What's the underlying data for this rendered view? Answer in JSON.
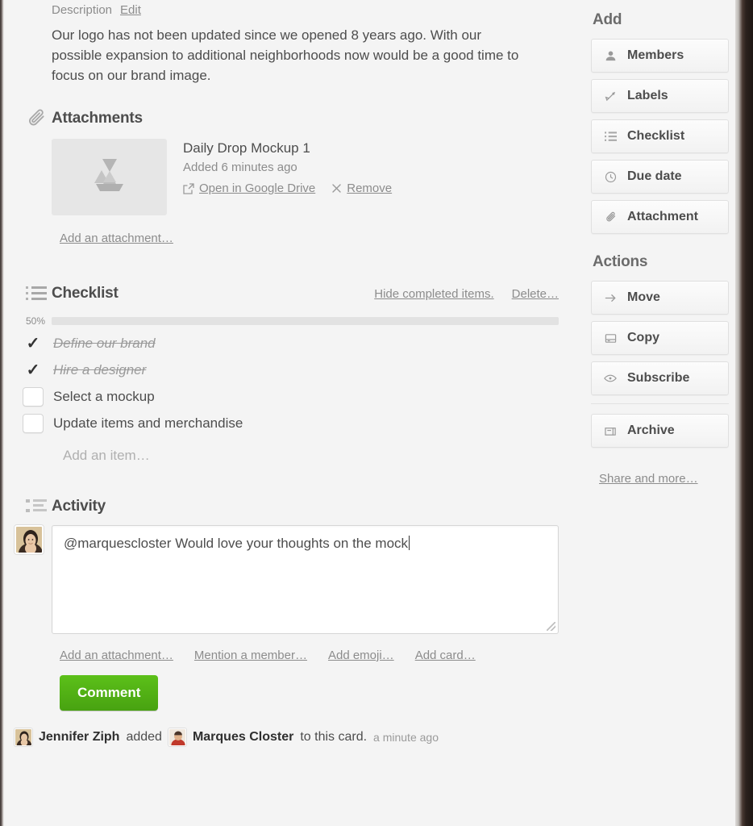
{
  "description": {
    "label": "Description",
    "edit_label": "Edit",
    "text": "Our logo has not been updated since we opened 8 years ago. With our possible expansion to additional neighborhoods now would be a good time to focus on our brand image."
  },
  "attachments": {
    "title": "Attachments",
    "icon": "paperclip-icon",
    "items": [
      {
        "name": "Daily Drop Mockup 1",
        "added": "Added 6 minutes ago",
        "thumb_icon": "google-drive-icon",
        "open_label": "Open in Google Drive",
        "remove_label": "Remove"
      }
    ],
    "add_label": "Add an attachment…"
  },
  "checklist": {
    "title": "Checklist",
    "icon": "checklist-icon",
    "hide_completed_label": "Hide completed items.",
    "delete_label": "Delete…",
    "progress_percent": "50%",
    "progress_value": 50,
    "items": [
      {
        "text": "Define our brand",
        "checked": true
      },
      {
        "text": "Hire a designer",
        "checked": true
      },
      {
        "text": "Select a mockup",
        "checked": false
      },
      {
        "text": "Update items and merchandise",
        "checked": false
      }
    ],
    "add_item_label": "Add an item…"
  },
  "activity": {
    "title": "Activity",
    "icon": "activity-icon",
    "comment_value": "@marquescloster Would love your thoughts on the mock",
    "comment_links": [
      "Add an attachment…",
      "Mention a member…",
      "Add emoji…",
      "Add card…"
    ],
    "comment_button": "Comment",
    "entries": [
      {
        "actor": "Jennifer Ziph",
        "verb": "added",
        "target": "Marques Closter",
        "suffix": "to this card.",
        "time": "a minute ago"
      }
    ]
  },
  "sidebar": {
    "add_title": "Add",
    "add_items": [
      {
        "label": "Members",
        "icon": "person-icon"
      },
      {
        "label": "Labels",
        "icon": "tag-icon"
      },
      {
        "label": "Checklist",
        "icon": "checklist-icon"
      },
      {
        "label": "Due date",
        "icon": "clock-icon"
      },
      {
        "label": "Attachment",
        "icon": "paperclip-icon"
      }
    ],
    "actions_title": "Actions",
    "action_items": [
      {
        "label": "Move",
        "icon": "arrow-right-icon"
      },
      {
        "label": "Copy",
        "icon": "copy-icon"
      },
      {
        "label": "Subscribe",
        "icon": "eye-icon"
      }
    ],
    "archive": {
      "label": "Archive",
      "icon": "archive-icon"
    },
    "share_label": "Share and more…"
  },
  "colors": {
    "progress_blue": "#3b97d3",
    "comment_green": "#4fad15",
    "background": "#f4f4f4",
    "text": "#4d4d4d",
    "muted": "#8c8c8c"
  }
}
